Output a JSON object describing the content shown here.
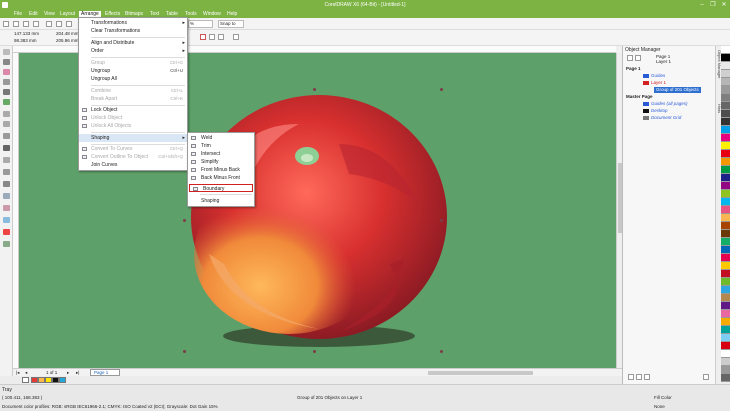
{
  "window": {
    "title": "CorelDRAW X6 (64-Bit) - [Untitled-1]",
    "minimize": "–",
    "restore": "❐",
    "close": "✕"
  },
  "menubar": {
    "items": [
      "File",
      "Edit",
      "View",
      "Layout",
      "Arrange",
      "Effects",
      "Bitmaps",
      "Text",
      "Table",
      "Tools",
      "Window",
      "Help"
    ],
    "active": "Arrange"
  },
  "toolbar": {
    "zoom": "%",
    "snap": "Snap to"
  },
  "propbar": {
    "x": "147.133 mm",
    "y": "98.383 mm",
    "w": "204.48 mm",
    "h": "205.96 mm"
  },
  "arrange_menu": {
    "items": [
      {
        "label": "Transformations",
        "shortcut": "",
        "arrow": true,
        "disabled": false
      },
      {
        "label": "Clear Transformations",
        "shortcut": "",
        "disabled": false
      },
      {
        "label": "Align and Distribute",
        "shortcut": "",
        "arrow": true,
        "disabled": false
      },
      {
        "label": "Order",
        "shortcut": "",
        "arrow": true,
        "disabled": false
      },
      {
        "label": "Group",
        "shortcut": "Ctrl+G",
        "disabled": true
      },
      {
        "label": "Ungroup",
        "shortcut": "Ctrl+U",
        "disabled": false
      },
      {
        "label": "Ungroup All",
        "shortcut": "",
        "disabled": false
      },
      {
        "label": "Combine",
        "shortcut": "Ctrl+L",
        "disabled": true
      },
      {
        "label": "Break Apart",
        "shortcut": "Ctrl+K",
        "disabled": true
      },
      {
        "label": "Lock Object",
        "shortcut": "",
        "disabled": false
      },
      {
        "label": "Unlock Object",
        "shortcut": "",
        "disabled": true
      },
      {
        "label": "Unlock All Objects",
        "shortcut": "",
        "disabled": true
      },
      {
        "label": "Shaping",
        "shortcut": "",
        "arrow": true,
        "disabled": false,
        "highlighted": true
      },
      {
        "label": "Convert To Curves",
        "shortcut": "Ctrl+Q",
        "disabled": true
      },
      {
        "label": "Convert Outline To Object",
        "shortcut": "Ctrl+Shift+Q",
        "disabled": true
      },
      {
        "label": "Join Curves",
        "shortcut": "",
        "disabled": false
      }
    ]
  },
  "shaping_submenu": {
    "items": [
      "Weld",
      "Trim",
      "Intersect",
      "Simplify",
      "Front Minus Back",
      "Back Minus Front",
      "Boundary",
      "Shaping"
    ],
    "outlined": "Boundary"
  },
  "object_manager": {
    "title": "Object Manager",
    "page_label": "Page 1",
    "layer_label": "Layer 1",
    "tree": [
      {
        "label": "Page 1",
        "bold": true
      },
      {
        "label": "Guides",
        "color": "#2a5bd7"
      },
      {
        "label": "Layer 1",
        "color": "#d42020"
      },
      {
        "label": "Group of 201 Objects",
        "selected": true
      },
      {
        "label": "Master Page",
        "bold": true
      },
      {
        "label": "Guides (all pages)",
        "color": "#2a5bd7"
      },
      {
        "label": "Desktop",
        "color": "#2a5bd7"
      },
      {
        "label": "Document Grid",
        "color": "#2a5bd7"
      }
    ]
  },
  "side_tabs": [
    "Object Manager",
    "Hints"
  ],
  "pagebar": {
    "page_count": "1 of 1",
    "page_tab": "Page 1"
  },
  "status": {
    "tray": "Tray",
    "coords": "( 100.411, 168.383 )",
    "selection": "Group of 201 Objects on Layer 1",
    "profile": "Document color profiles: RGB: sRGB IEC61966-2.1; CMYK: ISO Coated v2 (ECI); Grayscale: Dot Gain 15%",
    "fill": "Fill Color",
    "outline": "None"
  },
  "colors": {
    "accent": "#7cb342",
    "canvas": "#5ea06a"
  }
}
